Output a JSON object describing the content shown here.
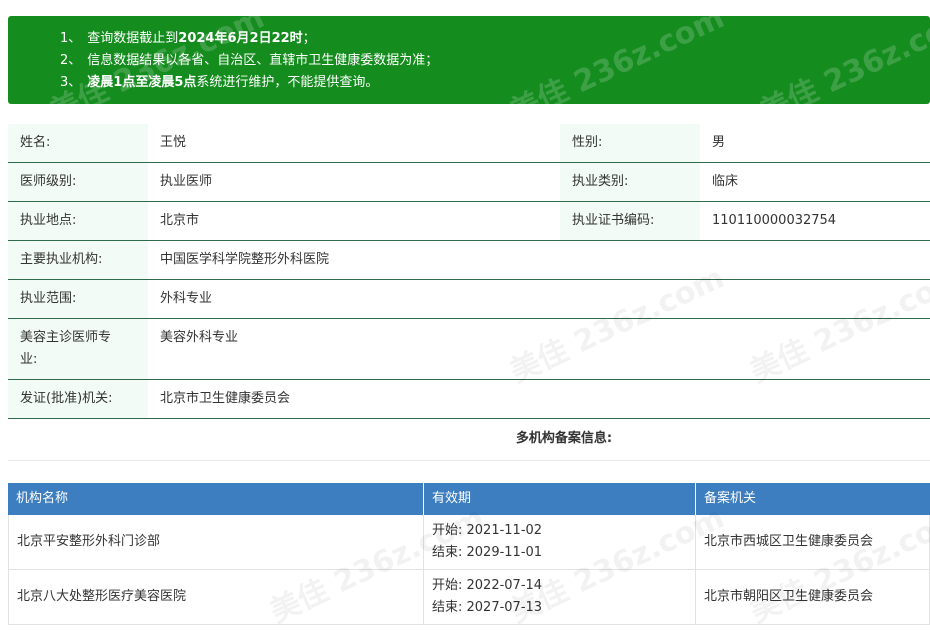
{
  "notice": {
    "lines": [
      {
        "num": "1、",
        "text": "查询数据截止到",
        "bold": "2024年6月2日22时",
        "suffix": "；"
      },
      {
        "num": "2、",
        "text": "信息数据结果以各省、自治区、直辖市卫生健康委数据为准；",
        "bold": "",
        "suffix": ""
      },
      {
        "num": "3、",
        "text": "",
        "bold": "凌晨1点至凌晨5点",
        "suffix": "系统进行维护，不能提供查询。"
      }
    ]
  },
  "info": {
    "name_label": "姓名:",
    "name_value": "王悦",
    "gender_label": "性别:",
    "gender_value": "男",
    "level_label": "医师级别:",
    "level_value": "执业医师",
    "category_label": "执业类别:",
    "category_value": "临床",
    "location_label": "执业地点:",
    "location_value": "北京市",
    "cert_label": "执业证书编码:",
    "cert_value": "110110000032754",
    "institution_label": "主要执业机构:",
    "institution_value": "中国医学科学院整形外科医院",
    "scope_label": "执业范围:",
    "scope_value": "外科专业",
    "cosmetic_label_1": "美容主诊医师专",
    "cosmetic_label_2": "业:",
    "cosmetic_value": "美容外科专业",
    "issuer_label": "发证(批准)机关:",
    "issuer_value": "北京市卫生健康委员会"
  },
  "multi_title": "多机构备案信息:",
  "org_table": {
    "headers": [
      "机构名称",
      "有效期",
      "备案机关"
    ],
    "rows": [
      {
        "name": "北京平安整形外科门诊部",
        "start": "开始:  2021-11-02",
        "end": "结束:  2029-11-01",
        "authority": "北京市西城区卫生健康委员会"
      },
      {
        "name": "北京八大处整形医疗美容医院",
        "start": "开始:  2022-07-14",
        "end": "结束:  2027-07-13",
        "authority": "北京市朝阳区卫生健康委员会"
      }
    ]
  },
  "watermark": "美佳 236z.com"
}
